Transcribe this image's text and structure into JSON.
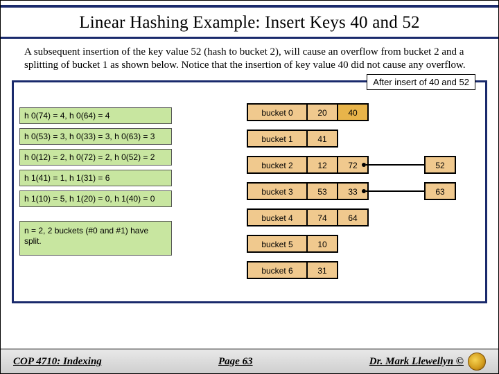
{
  "title": "Linear Hashing Example: Insert Keys 40 and 52",
  "body": "A subsequent insertion of the key value 52 (hash to bucket 2), will cause an overflow from bucket 2 and a splitting of bucket 1 as shown below.   Notice that the insertion of key value 40 did not cause any overflow.",
  "caption": "After insert of 40 and 52",
  "hash_lines": [
    "h 0(74) = 4, h 0(64) = 4",
    "h 0(53) = 3, h 0(33) = 3, h 0(63) = 3",
    "h 0(12) = 2, h 0(72) = 2, h 0(52) = 2",
    "h 1(41) = 1, h 1(31) = 6",
    "h 1(10) = 5, h 1(20) = 0, h 1(40) = 0"
  ],
  "note": "n = 2, 2 buckets (#0 and #1) have split.",
  "buckets": [
    {
      "label": "bucket 0",
      "cells": [
        "20",
        "40"
      ],
      "highlight": [
        false,
        true
      ],
      "overflow": null
    },
    {
      "label": "bucket 1",
      "cells": [
        "41",
        ""
      ],
      "highlight": [
        false,
        false
      ],
      "overflow": null
    },
    {
      "label": "bucket 2",
      "cells": [
        "12",
        "72"
      ],
      "highlight": [
        false,
        false
      ],
      "overflow": "52"
    },
    {
      "label": "bucket 3",
      "cells": [
        "53",
        "33"
      ],
      "highlight": [
        false,
        false
      ],
      "overflow": "63"
    },
    {
      "label": "bucket 4",
      "cells": [
        "74",
        "64"
      ],
      "highlight": [
        false,
        false
      ],
      "overflow": null
    },
    {
      "label": "bucket 5",
      "cells": [
        "10",
        ""
      ],
      "highlight": [
        false,
        false
      ],
      "overflow": null
    },
    {
      "label": "bucket 6",
      "cells": [
        "31",
        ""
      ],
      "highlight": [
        false,
        false
      ],
      "overflow": null
    }
  ],
  "footer": {
    "left": "COP 4710: Indexing",
    "mid": "Page 63",
    "right": "Dr. Mark Llewellyn ©"
  }
}
